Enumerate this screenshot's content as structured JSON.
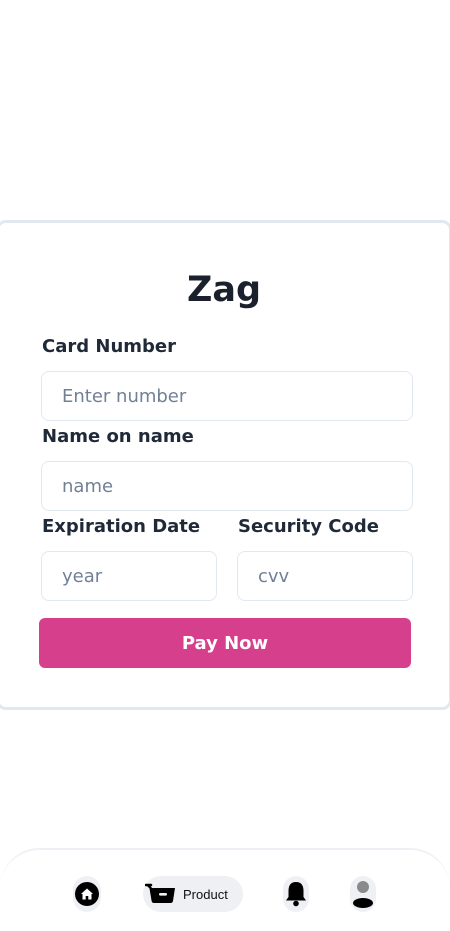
{
  "form": {
    "brand": "Zag",
    "card_number": {
      "label": "Card Number",
      "placeholder": "Enter number",
      "value": ""
    },
    "name": {
      "label": "Name on name",
      "placeholder": "name",
      "value": ""
    },
    "expiration": {
      "label": "Expiration Date",
      "placeholder": "year",
      "value": ""
    },
    "security": {
      "label": "Security Code",
      "placeholder": "cvv",
      "value": ""
    },
    "pay_button": "Pay Now",
    "accent_color": "#d63f8c"
  },
  "bottom_nav": {
    "items": [
      {
        "icon": "home-icon",
        "label": ""
      },
      {
        "icon": "cart-icon",
        "label": "Product",
        "active": true
      },
      {
        "icon": "bell-icon",
        "label": ""
      },
      {
        "icon": "user-icon",
        "label": ""
      }
    ]
  }
}
